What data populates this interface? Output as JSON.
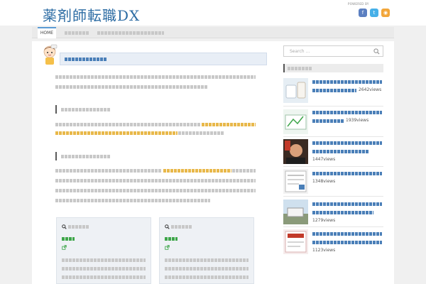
{
  "header": {
    "site_title": "薬剤師転職DX",
    "powered_by": "POWERED BY",
    "social": [
      {
        "icon": "facebook-icon",
        "glyph": "f",
        "color": "#5b7fc1"
      },
      {
        "icon": "twitter-icon",
        "glyph": "t",
        "color": "#46b0e8"
      },
      {
        "icon": "rss-icon",
        "glyph": "◉",
        "color": "#f2a63a"
      }
    ]
  },
  "nav": {
    "home_label": "HOME",
    "items": [
      "",
      "",
      ""
    ]
  },
  "article": {
    "title": "",
    "intro_lines": [
      "",
      ""
    ],
    "sections": [
      {
        "heading": "",
        "lines": [
          "",
          ""
        ]
      },
      {
        "heading": "",
        "lines": [
          "",
          "",
          "",
          ""
        ]
      }
    ],
    "boxes": [
      {
        "label": "",
        "link": "",
        "lines": [
          "",
          "",
          ""
        ]
      },
      {
        "label": "",
        "link": "",
        "lines": [
          "",
          "",
          ""
        ]
      }
    ]
  },
  "sidebar": {
    "search_placeholder": "Search ...",
    "ranking_title": "",
    "ranking": [
      {
        "title_lines": [
          ""
        ],
        "views": "2642views"
      },
      {
        "title_lines": [
          ""
        ],
        "views": "1939views"
      },
      {
        "title_lines": [
          ""
        ],
        "views": "1447views"
      },
      {
        "title_lines": [
          ""
        ],
        "views": "1348views"
      },
      {
        "title_lines": [
          ""
        ],
        "views": "1279views"
      },
      {
        "title_lines": [
          ""
        ],
        "views": "1123views"
      }
    ]
  },
  "colors": {
    "brand": "#2e6da4",
    "highlight": "#e8b84a",
    "link_green": "#3ea64a",
    "link_blue": "#4a7fb8"
  }
}
